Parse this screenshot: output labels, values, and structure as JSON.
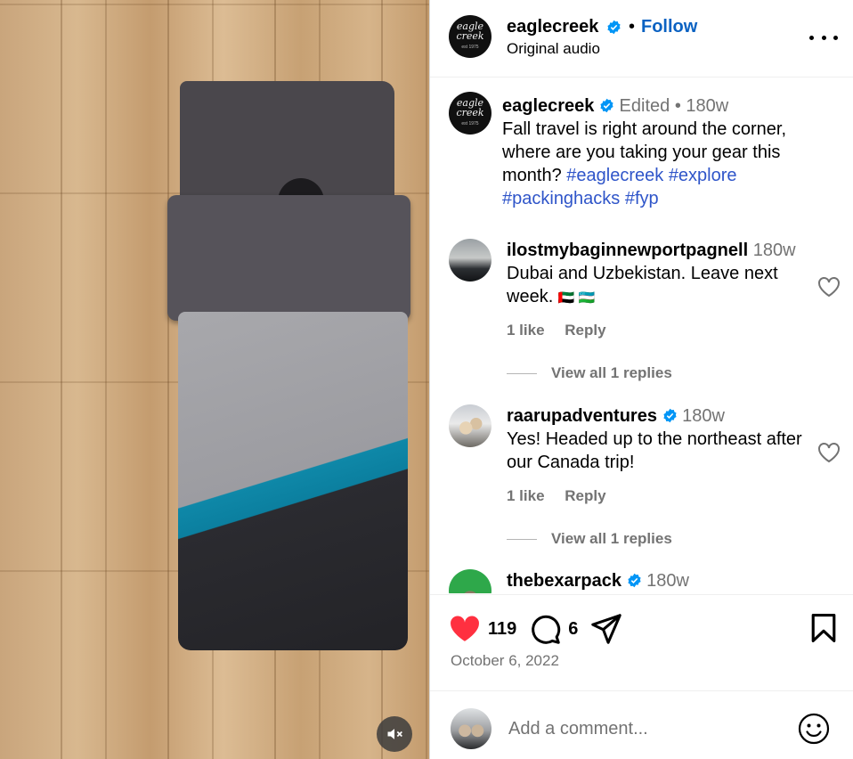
{
  "header": {
    "username": "eaglecreek",
    "follow_label": "Follow",
    "dot": "•",
    "audio": "Original audio",
    "logo_line1": "eagle",
    "logo_line2": "creek",
    "logo_small": "est 1975"
  },
  "caption": {
    "username": "eaglecreek",
    "edited": "Edited",
    "sep": "•",
    "time": "180w",
    "text": "Fall travel is right around the corner, where are you taking your gear this month?",
    "hashtags": [
      "#eaglecreek",
      "#explore",
      "#packinghacks",
      "#fyp"
    ]
  },
  "comments": [
    {
      "username": "ilostmybaginnewportpagnell",
      "time": "180w",
      "text": "Dubai and Uzbekistan. Leave next week.",
      "flags": "🇦🇪 🇺🇿",
      "likes": "1 like",
      "reply": "Reply",
      "view_replies": "View all 1 replies"
    },
    {
      "username": "raarupadventures",
      "time": "180w",
      "text": "Yes! Headed up to the northeast after our Canada trip!",
      "likes": "1 like",
      "reply": "Reply",
      "view_replies": "View all 1 replies"
    },
    {
      "username": "thebexarpack",
      "time": "180w"
    }
  ],
  "actions": {
    "likes": "119",
    "comments": "6",
    "date": "October 6, 2022"
  },
  "add_comment": {
    "placeholder": "Add a comment..."
  },
  "colors": {
    "accent_blue": "#0b62c2",
    "hashtag_blue": "#2f55c9",
    "like_red": "#ff3040",
    "muted": "#737373"
  }
}
